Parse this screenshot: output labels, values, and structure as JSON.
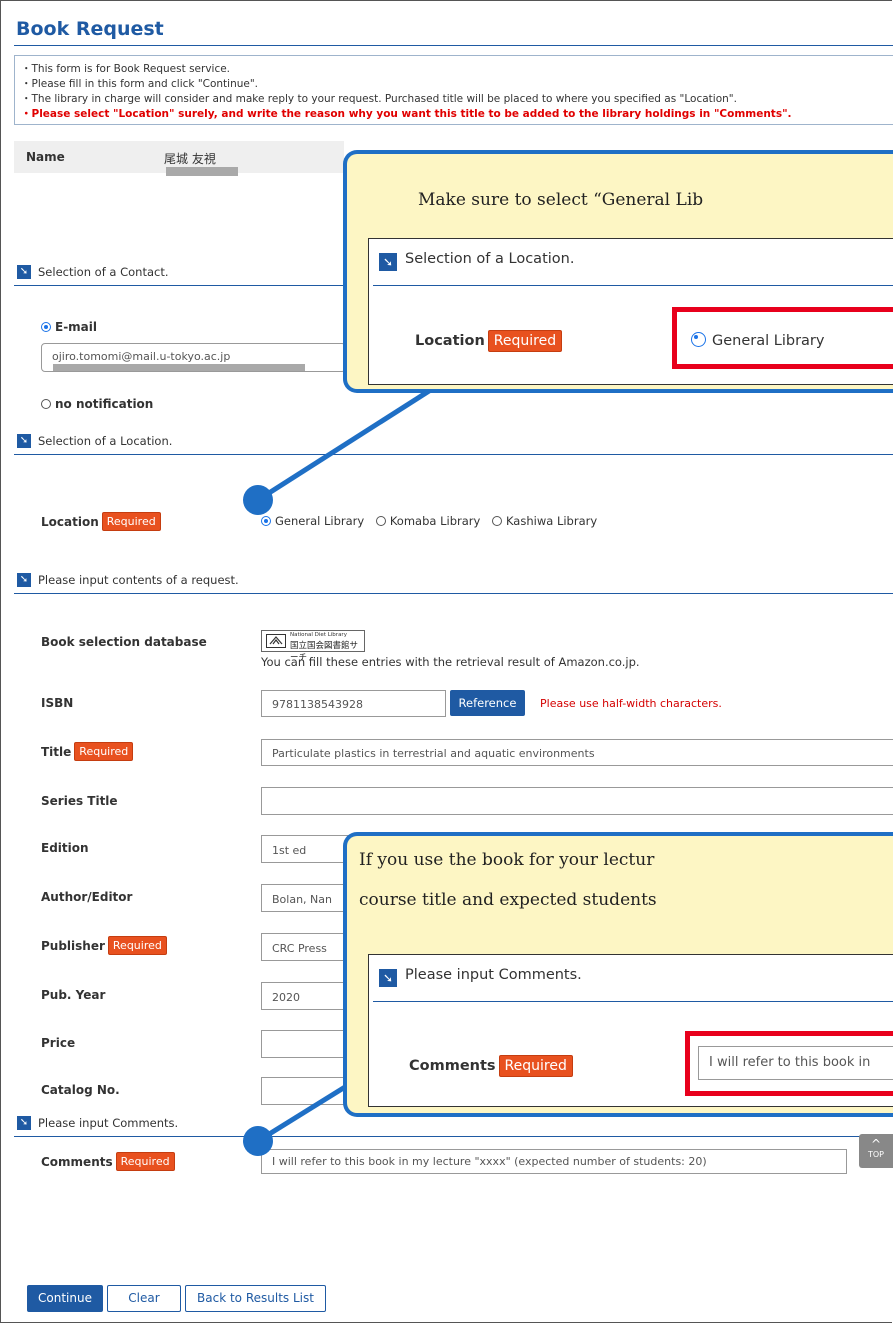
{
  "page": {
    "title": "Book Request",
    "notice": [
      "・This form is for Book Request service.",
      "・Please fill in this form and click \"Continue\".",
      "・The library in charge will consider and make reply to your request. Purchased title will be placed to where you specified as \"Location\".",
      "・Please select \"Location\" surely, and write the reason why you want this title to be added to the library holdings in \"Comments\"."
    ]
  },
  "name": {
    "label": "Name",
    "value": "尾城 友視"
  },
  "contact": {
    "section": "Selection of a Contact.",
    "email_label": "E-mail",
    "email_value": "ojiro.tomomi@mail.u-tokyo.ac.jp",
    "none_label": "no notification"
  },
  "location": {
    "section": "Selection of a Location.",
    "label": "Location",
    "required": "Required",
    "options": [
      "General Library",
      "Komaba Library",
      "Kashiwa Library"
    ]
  },
  "contents": {
    "section": "Please input contents of a request.",
    "db_label": "Book selection database",
    "db_logo_top": "National Diet Library",
    "db_logo_bottom": "国立国会図書館サーチ",
    "db_hint": "You can fill these entries with the retrieval result of Amazon.co.jp.",
    "isbn_label": "ISBN",
    "isbn_value": "9781138543928",
    "reference_button": "Reference",
    "isbn_hint": "Please use half-width characters.",
    "title_label": "Title",
    "title_value": "Particulate plastics in terrestrial and aquatic environments",
    "series_label": "Series Title",
    "edition_label": "Edition",
    "edition_value": "1st ed",
    "author_label": "Author/Editor",
    "author_value": "Bolan, Nan",
    "publisher_label": "Publisher",
    "publisher_value": "CRC Press",
    "pubyear_label": "Pub. Year",
    "pubyear_value": "2020",
    "price_label": "Price",
    "catalog_label": "Catalog No.",
    "required": "Required"
  },
  "comments": {
    "section": "Please input Comments.",
    "label": "Comments",
    "required": "Required",
    "value": "I will refer to this book in my lecture \"xxxx\" (expected number of students: 20)"
  },
  "top_button": {
    "arrow": "^",
    "label": "TOP"
  },
  "buttons": {
    "continue": "Continue",
    "clear": "Clear",
    "back": "Back to Results List"
  },
  "callout1": {
    "message": "Make sure to select “General Lib",
    "section": "Selection of a Location.",
    "label": "Location",
    "required": "Required",
    "option": "General Library"
  },
  "callout2": {
    "line1": "If you use the book for your lectur",
    "line2": "course title and expected students",
    "section": "Please input Comments.",
    "label": "Comments",
    "required": "Required",
    "value": "I will refer to this book in"
  },
  "colors": {
    "accent": "#1f5aa3",
    "required": "#e8511f",
    "warning": "#e00000",
    "callout_bg": "#fdf6c4",
    "callout_border": "#1f6fc5",
    "highlight": "#e8001c"
  }
}
